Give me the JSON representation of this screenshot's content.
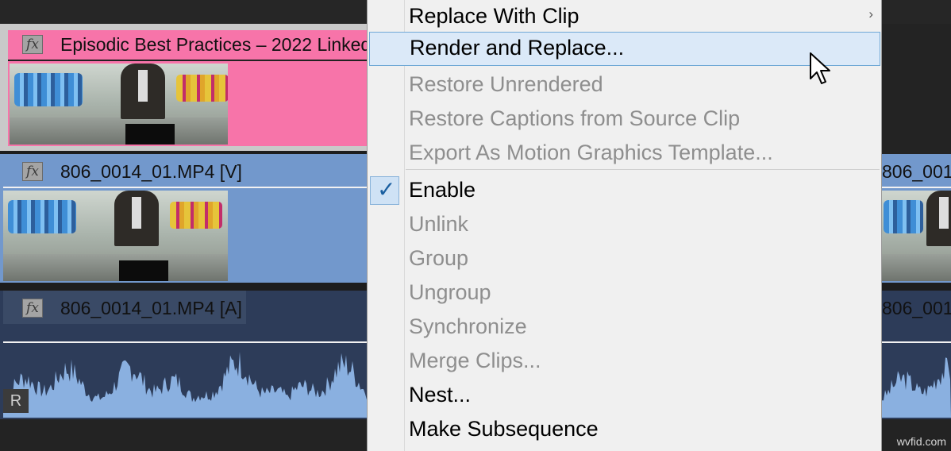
{
  "timeline": {
    "clips": [
      {
        "fx": "fx",
        "title": "Episodic Best Practices – 2022 Linked",
        "color": "#f774a9"
      },
      {
        "fx": "fx",
        "title": "806_0014_01.MP4 [V]",
        "color": "#7298cc"
      },
      {
        "fx": "fx",
        "title": "806_0014_01.MP4 [A]",
        "color": "#3a4a66"
      }
    ],
    "right_clip_video_title": "806_001",
    "right_clip_audio_title": "806_001",
    "audio_badge": "R",
    "colors": {
      "waveform": "#8ab0e0",
      "audio_bg": "#2d3c59",
      "video_bg": "#7298cc",
      "pink": "#f774a9"
    }
  },
  "menu": {
    "items": [
      {
        "label": "Replace With Clip",
        "enabled": true,
        "submenu": true,
        "arrow": "›"
      },
      {
        "label": "Render and Replace...",
        "enabled": true,
        "hover": true
      },
      {
        "label": "Restore Unrendered",
        "enabled": false
      },
      {
        "label": "Restore Captions from Source Clip",
        "enabled": false
      },
      {
        "label": "Export As Motion Graphics Template...",
        "enabled": false
      },
      {
        "label": "Enable",
        "enabled": true,
        "checked": true,
        "check": "✓"
      },
      {
        "label": "Unlink",
        "enabled": false
      },
      {
        "label": "Group",
        "enabled": false
      },
      {
        "label": "Ungroup",
        "enabled": false
      },
      {
        "label": "Synchronize",
        "enabled": false
      },
      {
        "label": "Merge Clips...",
        "enabled": false
      },
      {
        "label": "Nest...",
        "enabled": true
      },
      {
        "label": "Make Subsequence",
        "enabled": true
      }
    ]
  },
  "watermark": "wvfid.com"
}
